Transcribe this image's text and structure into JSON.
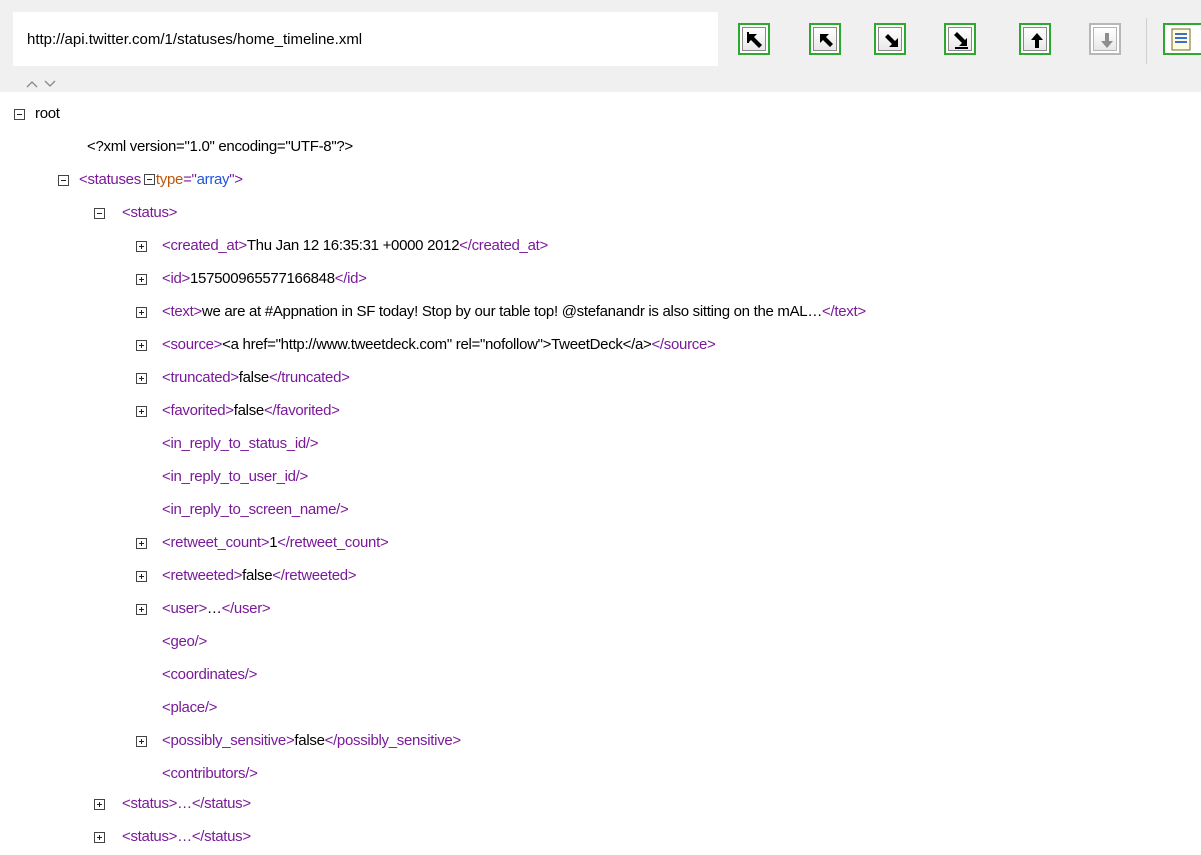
{
  "toolbar": {
    "url": "http://api.twitter.com/1/statuses/home_timeline.xml",
    "buttons": [
      {
        "name": "first",
        "icon": "arrow-up-left-bar-icon",
        "enabled": true
      },
      {
        "name": "previous",
        "icon": "arrow-up-left-icon",
        "enabled": true
      },
      {
        "name": "next",
        "icon": "arrow-down-right-icon",
        "enabled": true
      },
      {
        "name": "last",
        "icon": "arrow-down-right-bar-icon",
        "enabled": true
      },
      {
        "name": "up",
        "icon": "arrow-up-icon",
        "enabled": true
      },
      {
        "name": "down",
        "icon": "arrow-down-icon",
        "enabled": false
      }
    ],
    "doc_icon": "document-icon"
  },
  "colors": {
    "tag": "#7a1a9a",
    "text": "#000000",
    "attr_name": "#c0560a",
    "attr_value": "#2255dd",
    "button_border": "#2ea82e"
  },
  "tree": {
    "root": "root",
    "declaration": "<?xml version=\"1.0\" encoding=\"UTF-8\"?>",
    "statuses": {
      "open": "<statuses",
      "attr_name": "type",
      "eq": "=\"",
      "attr_value": "array",
      "close": "\">"
    },
    "status_open": "<status>",
    "children": [
      {
        "open": "<created_at>",
        "text": "Thu Jan 12 16:35:31 +0000 2012",
        "close": "</created_at>"
      },
      {
        "open": "<id>",
        "text": "157500965577166848",
        "close": "</id>"
      },
      {
        "open": "<text>",
        "text": "we are at #Appnation in SF today! Stop by our table top! @stefanandr is also sitting on the mAL…",
        "close": "</text>"
      },
      {
        "open": "<source>",
        "text": "<a href=\"http://www.tweetdeck.com\" rel=\"nofollow\">TweetDeck</a>",
        "close": "</source>"
      },
      {
        "open": "<truncated>",
        "text": "false",
        "close": "</truncated>"
      },
      {
        "open": "<favorited>",
        "text": "false",
        "close": "</favorited>"
      },
      {
        "empty": "<in_reply_to_status_id/>"
      },
      {
        "empty": "<in_reply_to_user_id/>"
      },
      {
        "empty": "<in_reply_to_screen_name/>"
      },
      {
        "open": "<retweet_count>",
        "text": "1",
        "close": "</retweet_count>"
      },
      {
        "open": "<retweeted>",
        "text": "false",
        "close": "</retweeted>"
      },
      {
        "open": "<user>",
        "text": "…",
        "close": "</user>"
      },
      {
        "empty": "<geo/>"
      },
      {
        "empty": "<coordinates/>"
      },
      {
        "empty": "<place/>"
      },
      {
        "open": "<possibly_sensitive>",
        "text": "false",
        "close": "</possibly_sensitive>"
      },
      {
        "empty": "<contributors/>"
      }
    ],
    "collapsed_status_1": "<status>…</status>",
    "collapsed_status_2": "<status>…</status>"
  }
}
